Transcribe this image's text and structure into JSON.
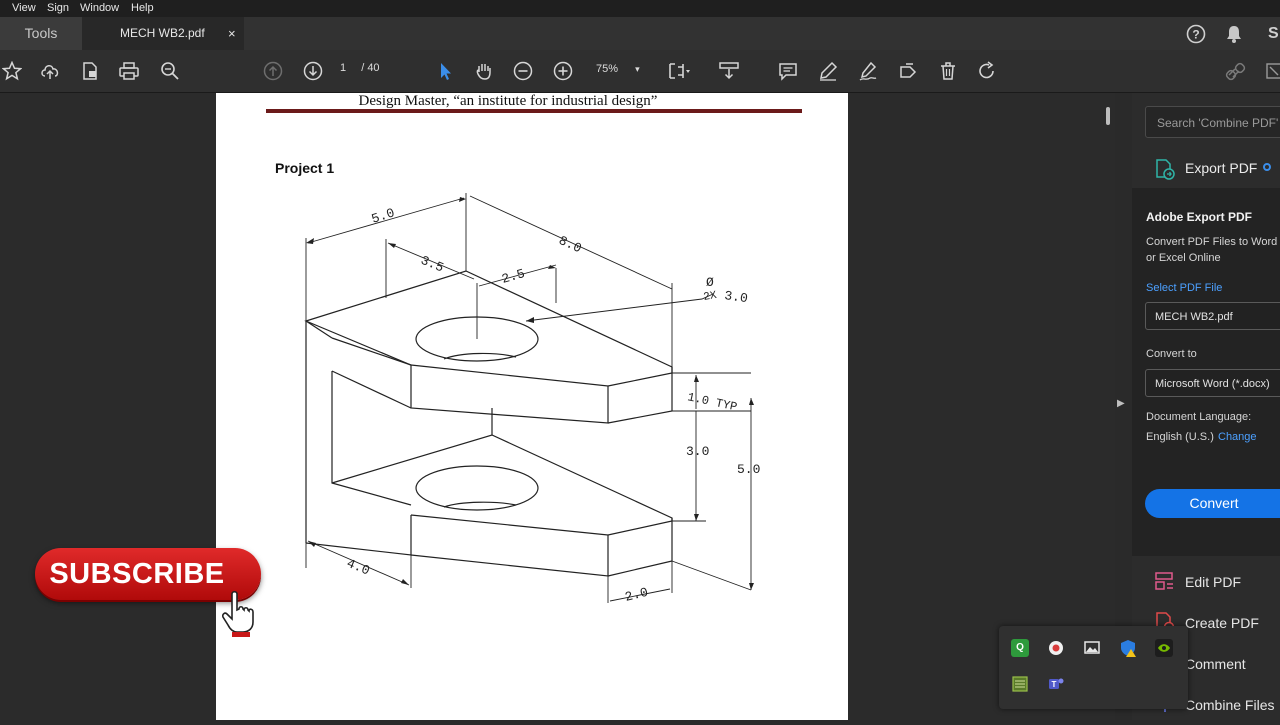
{
  "menu": [
    "View",
    "Sign",
    "Window",
    "Help"
  ],
  "tabs": {
    "tools": "Tools",
    "document": "MECH WB2.pdf",
    "close": "×"
  },
  "top_right": {
    "user_initial": "S"
  },
  "toolbar": {
    "page_current": "1",
    "page_sep": "/",
    "page_total": "40",
    "zoom": "75%"
  },
  "document": {
    "header": "Design Master, “an institute for industrial design”",
    "project_title": "Project 1",
    "dimensions": {
      "d1": "5.0",
      "d2": "8.0",
      "d3": "3.5",
      "d4": "2.5",
      "hole1": "Ø",
      "hole2": "2X",
      "hole3": "3.0",
      "typ": "1.0 TYP",
      "d5": "3.0",
      "d6": "5.0",
      "d7": "4.0",
      "d8": "2.0"
    }
  },
  "right_panel": {
    "search_placeholder": "Search 'Combine PDF'",
    "export_tool": "Export PDF",
    "title": "Adobe Export PDF",
    "desc1": "Convert PDF Files to Word",
    "desc2": "or Excel Online",
    "select_label": "Select PDF File",
    "file_value": "MECH WB2.pdf",
    "convert_to_label": "Convert to",
    "convert_to_value": "Microsoft Word (*.docx)",
    "lang_label": "Document Language:",
    "lang_value": "English (U.S.)",
    "lang_change": "Change",
    "convert_button": "Convert",
    "tools": [
      "Edit PDF",
      "Create PDF",
      "Comment",
      "Combine Files"
    ]
  },
  "overlay": {
    "subscribe": "SUBSCRIBE"
  },
  "colors": {
    "accent": "#1473e6",
    "link": "#4ca0ff",
    "subscribe": "#d01818"
  }
}
